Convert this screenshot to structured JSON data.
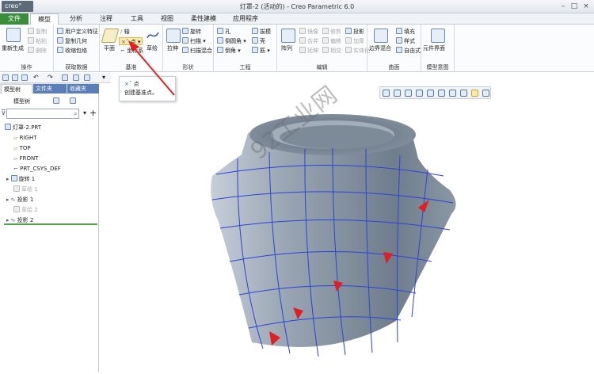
{
  "app": {
    "logo": "creo°",
    "window_title": "灯罩-2 (活动的) - Creo Parametric 6.0"
  },
  "menu": {
    "tabs": [
      "文件",
      "模型",
      "分析",
      "注释",
      "工具",
      "视图",
      "柔性建模",
      "应用程序"
    ]
  },
  "ribbon": {
    "groups": {
      "operations": {
        "label": "操作",
        "regenerate": "重新生成",
        "copy": "复制",
        "paste": "粘贴",
        "delete": "删除"
      },
      "get_data": {
        "label": "获取数据",
        "udf": "用户定义特征",
        "copy_geom": "复制几何",
        "shrinkwrap": "收缩包络"
      },
      "datum": {
        "label": "基准",
        "plane": "平面",
        "axis": "轴",
        "point": "点",
        "csys": "坐标系",
        "sketch": "草绘"
      },
      "shapes": {
        "label": "形状",
        "extrude": "拉伸",
        "revolve": "旋转",
        "sweep": "扫描",
        "blend": "扫描混合"
      },
      "engineering": {
        "label": "工程",
        "hole": "孔",
        "round": "倒圆角",
        "chamfer": "倒角",
        "draft": "拔模",
        "shell": "壳",
        "rib": "筋"
      },
      "editing": {
        "label": "编辑",
        "pattern": "阵列",
        "mirror": "镜像",
        "extend": "延伸",
        "project": "投影",
        "trim": "修剪",
        "offset": "偏移",
        "thicken": "加厚",
        "merge": "合并",
        "intersect": "相交",
        "solidify": "实体化"
      },
      "surfaces": {
        "label": "曲面",
        "boundary": "边界混合",
        "fill": "填充",
        "style": "样式",
        "freeform": "自由式"
      },
      "model_intent": {
        "label": "模型意图",
        "component_interface": "元件界面"
      }
    }
  },
  "tooltip": {
    "title": "点",
    "description": "创建基准点。"
  },
  "panel": {
    "tabs": [
      "模型树",
      "文件夹",
      "收藏夹"
    ],
    "tree_label": "模型树",
    "filter_placeholder": "",
    "tree": [
      {
        "label": "灯罩-2.PRT",
        "dim": false
      },
      {
        "label": "RIGHT",
        "dim": false
      },
      {
        "label": "TOP",
        "dim": false
      },
      {
        "label": "FRONT",
        "dim": false
      },
      {
        "label": "PRT_CSYS_DEF",
        "dim": false
      },
      {
        "label": "旋转 1",
        "dim": false
      },
      {
        "label": "草绘 1",
        "dim": true
      },
      {
        "label": "投影 1",
        "dim": false
      },
      {
        "label": "草绘 2",
        "dim": true
      },
      {
        "label": "投影 2",
        "dim": false
      }
    ]
  },
  "watermark": "92工业网",
  "colors": {
    "file_tab": "#3a8e3a",
    "model_shade": "#7f8e9d",
    "curve": "#2a43d8",
    "annotation": "#e02020"
  }
}
